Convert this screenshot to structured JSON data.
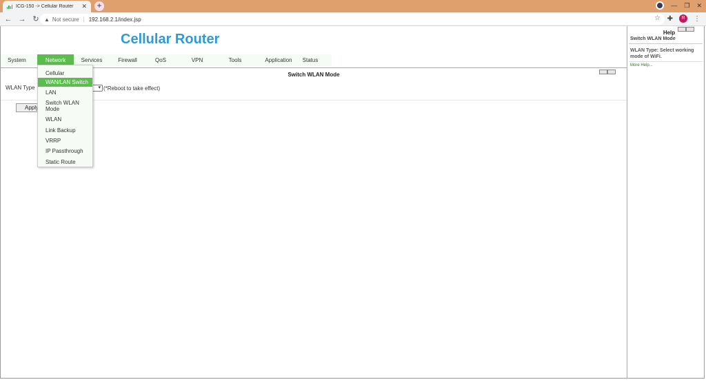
{
  "browser": {
    "tab_title": "ICG-150 -> Cellular Router",
    "tab_close": "✕",
    "new_tab": "+",
    "security_label": "Not secure",
    "url": "192.168.2.1/index.jsp",
    "profile_initial": "R"
  },
  "header": {
    "brand": "Cellular Router"
  },
  "menu": {
    "items": [
      {
        "label": "System"
      },
      {
        "label": "Network"
      },
      {
        "label": "Services"
      },
      {
        "label": "Firewall"
      },
      {
        "label": "QoS"
      },
      {
        "label": "VPN"
      },
      {
        "label": "Tools"
      },
      {
        "label": "Application"
      },
      {
        "label": "Status"
      }
    ],
    "active_index": 1,
    "active_color": "#5bbd4d"
  },
  "dropdown": {
    "items": [
      {
        "label": "Cellular"
      },
      {
        "label": "WAN/LAN Switch"
      },
      {
        "label": "LAN"
      },
      {
        "label": "Switch WLAN Mode"
      },
      {
        "label": "WLAN"
      },
      {
        "label": "Link Backup"
      },
      {
        "label": "VRRP"
      },
      {
        "label": "IP Passthrough"
      },
      {
        "label": "Static Route"
      }
    ],
    "highlighted_index": 1
  },
  "content": {
    "section_title": "Switch WLAN Mode",
    "wlan_type_label": "WLAN Type",
    "reboot_note": "(*Reboot to take effect)",
    "apply_label": "Apply"
  },
  "help": {
    "title": "Help",
    "subtitle": "Switch WLAN Mode",
    "description": "WLAN Type: Select working mode of WiFi.",
    "more_link": "More Help..."
  },
  "colors": {
    "brand": "#2e9bd6",
    "accent_green": "#5bbd4d",
    "tabstrip": "#e0a06e"
  }
}
